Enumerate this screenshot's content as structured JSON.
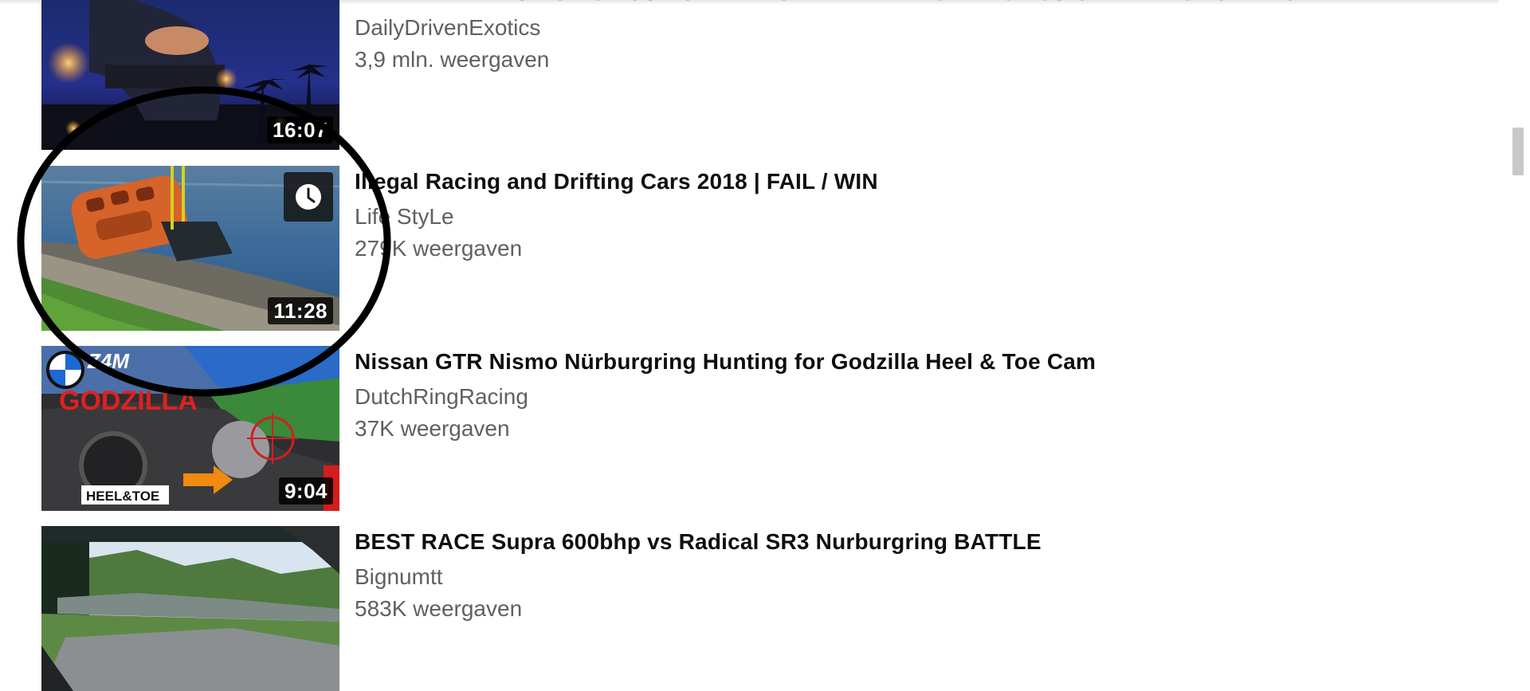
{
  "videos": [
    {
      "title": "BEVERLY HILLS POLICE USE UNLAWFUL INTIMIDATION TACTICS ON LAMBORGHINI OWNER",
      "channel": "DailyDrivenExotics",
      "views": "3,9 mln. weergaven",
      "duration": "16:07"
    },
    {
      "title": "Illegal Racing and Drifting Cars 2018 | FAIL / WIN",
      "channel": "Life StyLe",
      "views": "279K weergaven",
      "duration": "11:28",
      "watch_later_icon": "clock-icon"
    },
    {
      "title": "Nissan GTR Nismo Nürburgring Hunting for Godzilla Heel & Toe Cam",
      "channel": "DutchRingRacing",
      "views": "37K weergaven",
      "duration": "9:04",
      "thumbnail_text": {
        "brand": "Z4M",
        "headline": "GODZILLA",
        "badge": "HEEL&TOE"
      }
    },
    {
      "title": "BEST RACE Supra 600bhp vs Radical SR3 Nurburgring BATTLE",
      "channel": "Bignumtt",
      "views": "583K weergaven"
    }
  ],
  "colors": {
    "title": "#0f0f0f",
    "meta": "#606060",
    "annotation": "#000000"
  }
}
